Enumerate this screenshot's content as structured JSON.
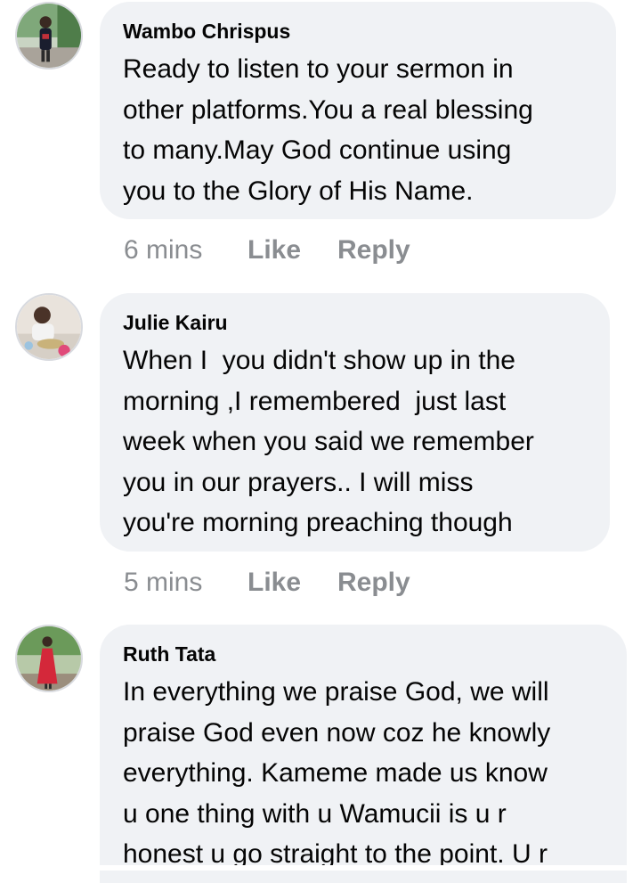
{
  "comments": [
    {
      "author": "Wambo Chrispus",
      "text": "Ready to listen to your sermon in\nother platforms.You a real blessing\nto many.May God continue using\nyou to the Glory of His Name.",
      "time": "6 mins",
      "like_label": "Like",
      "reply_label": "Reply"
    },
    {
      "author": "Julie Kairu",
      "text": "When I  you didn't show up in the\nmorning ,I remembered  just last\nweek when you said we remember\nyou in our prayers.. I will miss\nyou're morning preaching though",
      "time": "5 mins",
      "like_label": "Like",
      "reply_label": "Reply"
    },
    {
      "author": "Ruth Tata",
      "text": "In everything we praise God, we will\npraise God even now coz he knowly\neverything. Kameme made us know\nu one thing with u Wamucii is u r\nhonest u go straight to the point. U r"
    }
  ],
  "colors": {
    "bubble": "#f0f2f5",
    "meta": "#8a8d91",
    "text": "#050505"
  }
}
